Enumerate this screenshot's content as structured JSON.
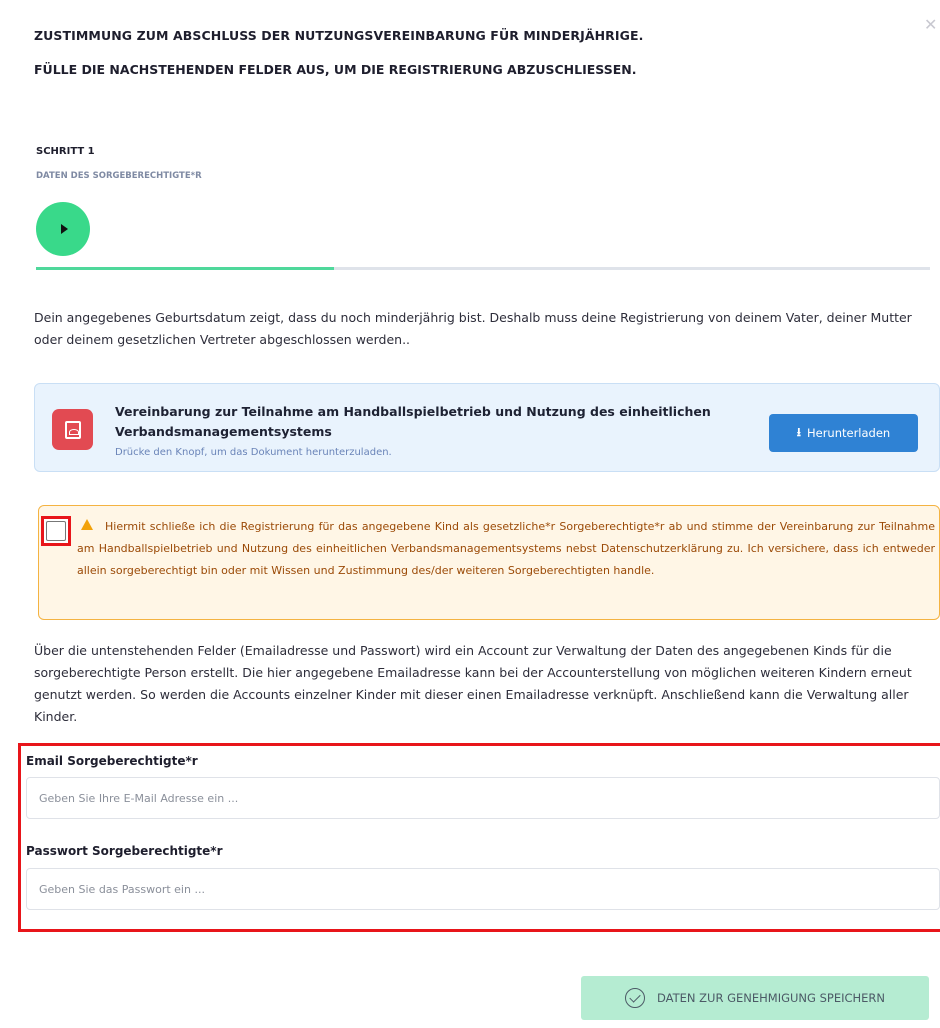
{
  "header": {
    "title": "ZUSTIMMUNG ZUM ABSCHLUSS DER NUTZUNGSVEREINBARUNG FÜR MINDERJÄHRIGE.",
    "subtitle": "FÜLLE DIE NACHSTEHENDEN FELDER AUS, UM DIE REGISTRIERUNG ABZUSCHLIESSEN.",
    "close_glyph": "✕"
  },
  "step": {
    "title": "SCHRITT 1",
    "description": "DATEN DES SORGEBERECHTIGTE*R",
    "progress_fraction": 0.333,
    "icon": "play-icon",
    "active_color": "#39d98a"
  },
  "intro_text": "Dein angegebenes Geburtsdatum zeigt, dass du noch minderjährig bist. Deshalb muss deine Registrierung von deinem Vater, deiner Mutter oder deinem gesetzlichen Vertreter abgeschlossen werden..",
  "document": {
    "icon": "pdf-icon",
    "title": "Vereinbarung zur Teilnahme am Handballspielbetrieb und Nutzung des einheitlichen Verbandsmanagementsystems",
    "hint": "Drücke den Knopf, um das Dokument herunterzuladen.",
    "download_label": "Herunterladen",
    "download_icon": "download-icon",
    "download_glyph": "⭳"
  },
  "consent": {
    "checked": false,
    "icon": "warning-icon",
    "text": "Hiermit schließe ich die Registrierung für das angegebene Kind als gesetzliche*r Sorgeberechtigte*r ab und stimme der Vereinbarung zur Teilnahme am Handballspielbetrieb und Nutzung des einheitlichen Verbandsmanagementsystems nebst Datenschutzerklärung zu. Ich versichere, dass ich entweder allein sorgeberechtigt bin oder mit Wissen und Zustimmung des/der weiteren Sorgeberechtigten handle."
  },
  "account_text": "Über die untenstehenden Felder (Emailadresse und Passwort) wird ein Account zur Verwaltung der Daten des angegebenen Kinds für die sorgeberechtigte Person erstellt. Die hier angegebene Emailadresse kann bei der Accounterstellung von möglichen weiteren Kindern erneut genutzt werden. So werden die Accounts einzelner Kinder mit dieser einen Emailadresse verknüpft. Anschließend kann die Verwaltung aller Kinder.",
  "form": {
    "email_label": "Email Sorgeberechtigte*r",
    "email_placeholder": "Geben Sie Ihre E-Mail Adresse ein ...",
    "email_value": "",
    "password_label": "Passwort Sorgeberechtigte*r",
    "password_placeholder": "Geben Sie das Passwort ein ...",
    "password_value": ""
  },
  "actions": {
    "save_label": "DATEN ZUR GENEHMIGUNG SPEICHERN",
    "save_icon": "check-circle-icon"
  },
  "colors": {
    "accent_green": "#39d98a",
    "download_blue": "#2f82d4",
    "pdf_red": "#e24a52",
    "warning_orange": "#f4b342",
    "highlight_red": "#e8151a"
  }
}
